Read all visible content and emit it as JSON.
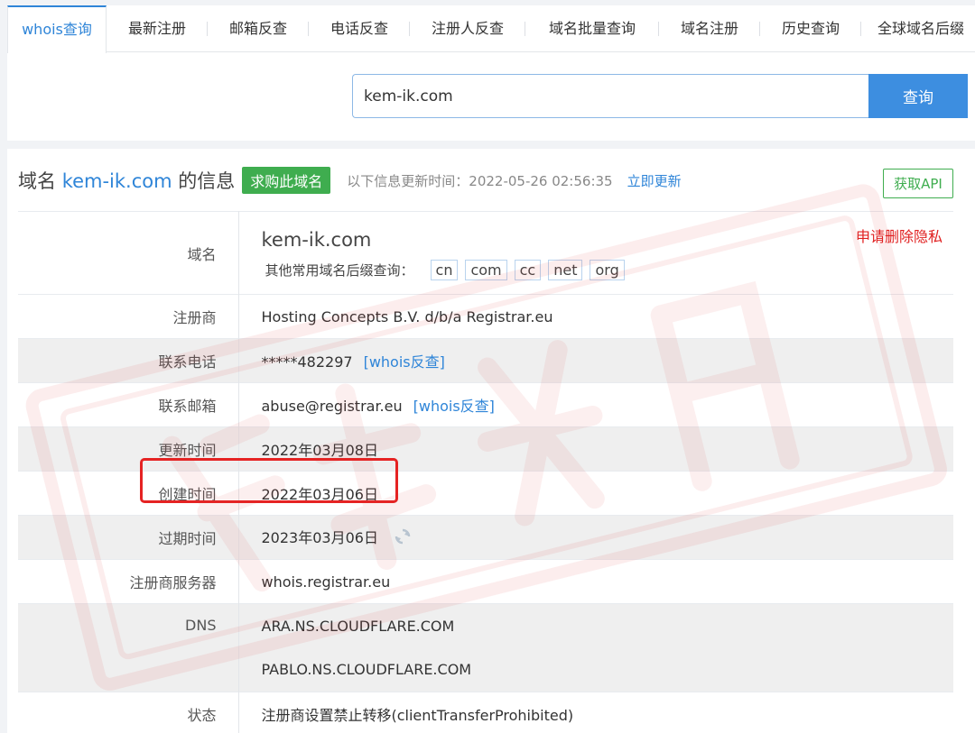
{
  "tabs": [
    {
      "label": "whois查询",
      "active": true
    },
    {
      "label": "最新注册"
    },
    {
      "label": "邮箱反查"
    },
    {
      "label": "电话反查"
    },
    {
      "label": "注册人反查"
    },
    {
      "label": "域名批量查询"
    },
    {
      "label": "域名注册"
    },
    {
      "label": "历史查询"
    },
    {
      "label": "全球域名后缀"
    }
  ],
  "search": {
    "value": "kem-ik.com",
    "button_label": "查询"
  },
  "header": {
    "title_prefix": "域名",
    "domain": "kem-ik.com",
    "title_suffix": "的信息",
    "buy_label": "求购此域名",
    "update_text": "以下信息更新时间：2022-05-26 02:56:35",
    "update_link": "立即更新",
    "api_label": "获取API"
  },
  "rows": {
    "domain": {
      "label": "域名",
      "value": "kem-ik.com",
      "privacy_link": "申请删除隐私",
      "suffix_prompt": "其他常用域名后缀查询：",
      "suffixes": [
        "cn",
        "com",
        "cc",
        "net",
        "org"
      ]
    },
    "registrar": {
      "label": "注册商",
      "value": "Hosting Concepts B.V. d/b/a Registrar.eu"
    },
    "phone": {
      "label": "联系电话",
      "value": "*****482297",
      "link": "[whois反查]"
    },
    "email": {
      "label": "联系邮箱",
      "value": "abuse@registrar.eu",
      "link": "[whois反查]"
    },
    "updated": {
      "label": "更新时间",
      "value": "2022年03月08日"
    },
    "created": {
      "label": "创建时间",
      "value": "2022年03月06日"
    },
    "expires": {
      "label": "过期时间",
      "value": "2023年03月06日"
    },
    "server": {
      "label": "注册商服务器",
      "value": "whois.registrar.eu"
    },
    "dns": {
      "label": "DNS",
      "values": [
        "ARA.NS.CLOUDFLARE.COM",
        "PABLO.NS.CLOUDFLARE.COM"
      ]
    },
    "status": {
      "label": "状态",
      "value": "注册商设置禁止转移(clientTransferProhibited)"
    }
  },
  "colors": {
    "accent": "#2f85d8",
    "green": "#3fad4f",
    "highlight": "#e52323"
  }
}
